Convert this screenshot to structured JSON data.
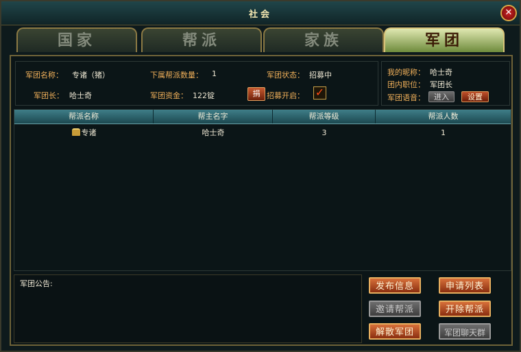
{
  "window": {
    "title": "社会",
    "close_label": "✕"
  },
  "tabs": [
    {
      "label": "国家",
      "active": false
    },
    {
      "label": "帮派",
      "active": false
    },
    {
      "label": "家族",
      "active": false
    },
    {
      "label": "军团",
      "active": true
    }
  ],
  "info": {
    "legion_name_label": "军团名称：",
    "legion_name_value": "专诸（猪）",
    "sub_count_label": "下属帮派数量：",
    "sub_count_value": "1",
    "status_label": "军团状态：",
    "status_value": "招募中",
    "leader_label": "军团长：",
    "leader_value": "哈士奇",
    "funds_label": "军团资金：",
    "funds_value": "122锭",
    "donate_label": "捐",
    "recruit_label": "招募开启：",
    "recruit_enabled": true
  },
  "profile": {
    "nickname_label": "我的昵称：",
    "nickname_value": "哈士奇",
    "position_label": "团内职位：",
    "position_value": "军团长",
    "voice_label": "军团语音：",
    "enter_label": "进入",
    "settings_label": "设置"
  },
  "table": {
    "headers": [
      "帮派名称",
      "帮主名字",
      "帮派等级",
      "帮派人数"
    ],
    "rows": [
      {
        "name": "专诸",
        "leader": "哈士奇",
        "level": "3",
        "members": "1"
      }
    ]
  },
  "notice": {
    "label": "军团公告:"
  },
  "actions": {
    "publish": "发布信息",
    "apply_list": "申请列表",
    "invite": "邀请帮派",
    "expel": "开除帮派",
    "disband": "解散军团",
    "chat": "军团聊天群"
  },
  "colors": {
    "accent_orange": "#f1b05a",
    "header_teal": "#3f7e88",
    "tab_active": "#dfe7b0",
    "button_orange": "#d7703a"
  }
}
